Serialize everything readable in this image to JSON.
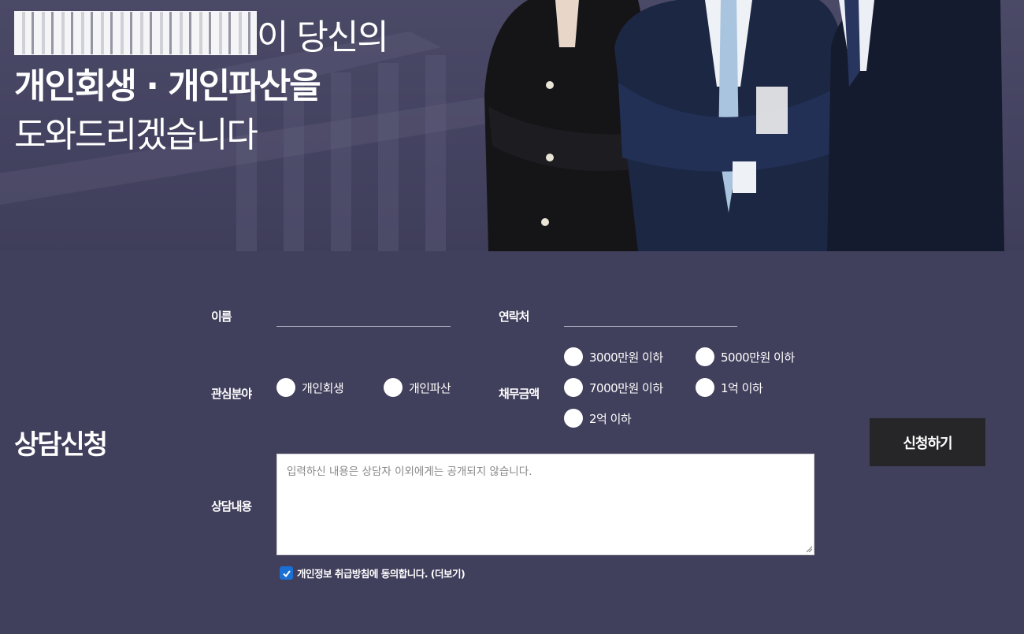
{
  "hero": {
    "line1_suffix": "이 당신의",
    "line2": "개인회생 · 개인파산을",
    "line3": "도와드리겠습니다"
  },
  "form": {
    "title": "상담신청",
    "name_label": "이름",
    "name_value": "",
    "contact_label": "연락처",
    "contact_value": "",
    "interest_label": "관심분야",
    "interest_options": [
      "개인회생",
      "개인파산"
    ],
    "debt_label": "채무금액",
    "debt_options": [
      "3000만원 이하",
      "5000만원 이하",
      "7000만원 이하",
      "1억 이하",
      "2억 이하"
    ],
    "content_label": "상담내용",
    "content_placeholder": "입력하신 내용은 상담자 이외에게는 공개되지 않습니다.",
    "agree_text": "개인정보 취급방침에 동의합니다. (더보기)",
    "agree_checked": true,
    "submit_label": "신청하기"
  },
  "colors": {
    "background": "#403f5c",
    "button": "#262628",
    "checkbox": "#1a6fd4"
  }
}
